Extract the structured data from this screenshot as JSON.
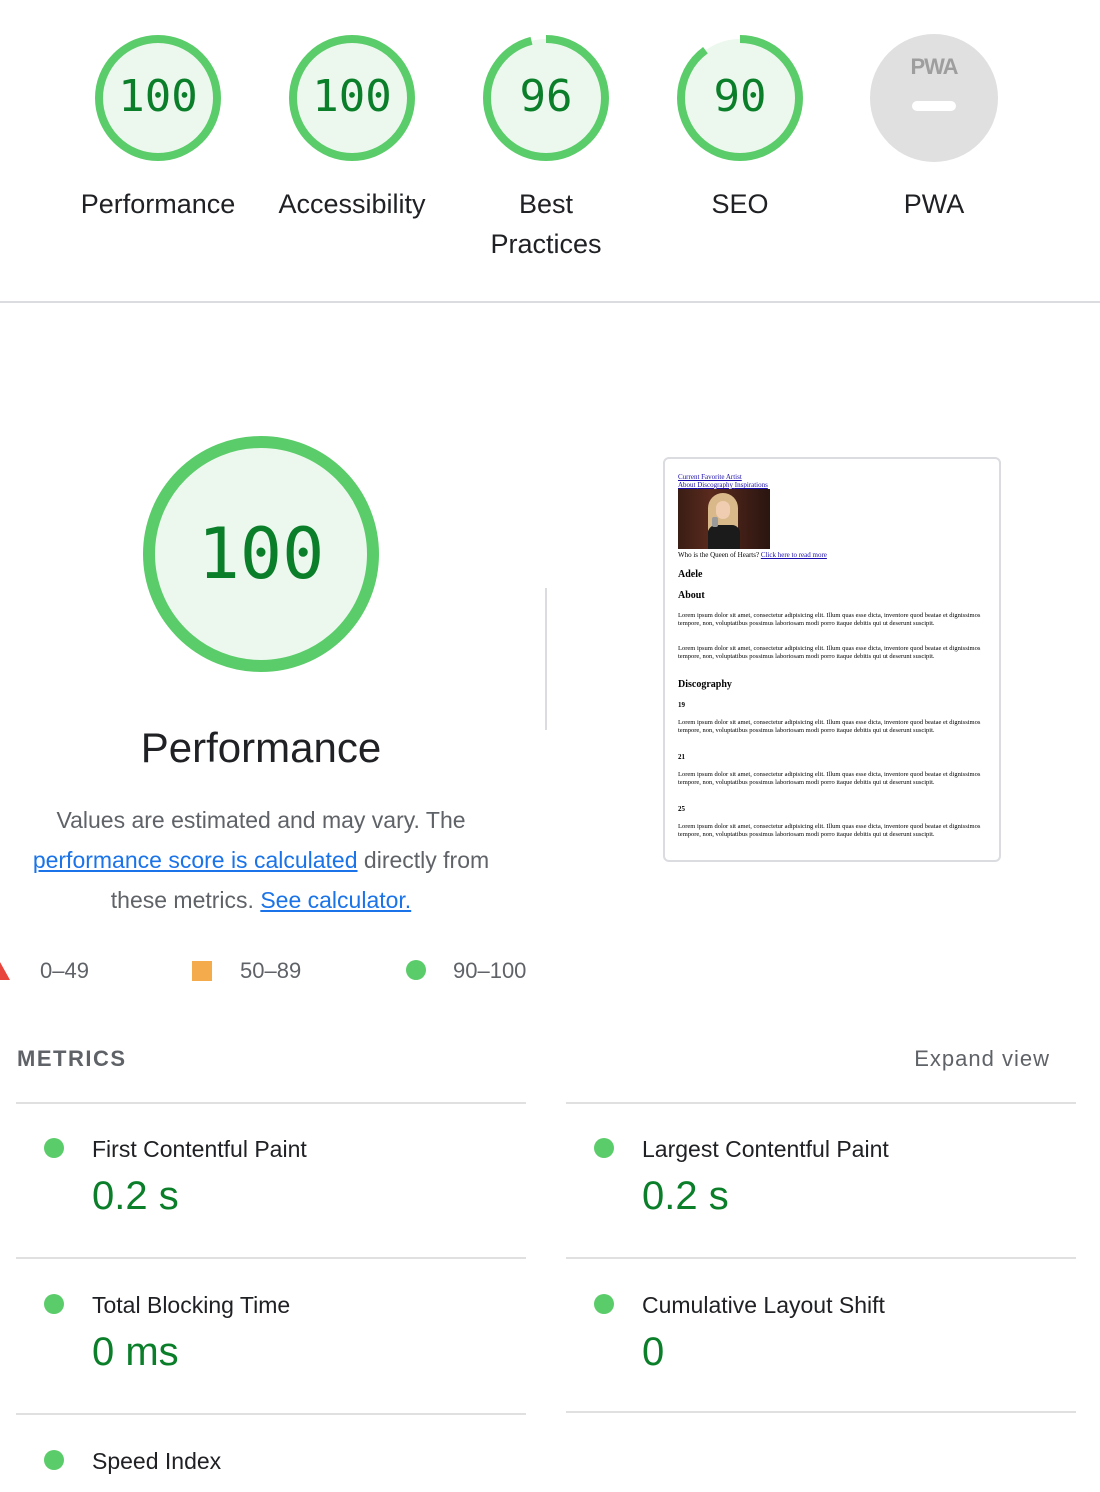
{
  "categories": [
    {
      "label": "Performance",
      "score": "100",
      "score_fraction": 1.0
    },
    {
      "label": "Accessibility",
      "score": "100",
      "score_fraction": 1.0
    },
    {
      "label": "Best Practices",
      "score": "96",
      "score_fraction": 0.96
    },
    {
      "label": "SEO",
      "score": "90",
      "score_fraction": 0.9
    },
    {
      "label": "PWA",
      "badge_text": "PWA",
      "score": "—"
    }
  ],
  "colors": {
    "pass_ring": "#5bcc6a",
    "pass_fill": "#ecf8ee",
    "pass_text": "#0b7e2a",
    "average": "#f4ab4b",
    "fail": "#e8453c",
    "na_fill": "#e0e0e0",
    "link": "#1a73e8"
  },
  "performance": {
    "score": "100",
    "score_fraction": 1.0,
    "title": "Performance",
    "desc_part1": "Values are estimated and may vary. The ",
    "desc_link1": "performance score is calculated",
    "desc_part2": " directly from these metrics. ",
    "desc_link2": "See calculator."
  },
  "legend": [
    {
      "shape": "triangle",
      "range": "0–49"
    },
    {
      "shape": "square",
      "range": "50–89"
    },
    {
      "shape": "circle",
      "range": "90–100"
    }
  ],
  "thumbnail": {
    "site_title": "Current Favorite Artist",
    "nav": [
      "About",
      "Discography",
      "Inspirations"
    ],
    "caption": "Who is the Queen of Hearts? ",
    "caption_link": "Click here to read more",
    "heading": "Adele",
    "about_heading": "About",
    "lorem": "Lorem ipsum dolor sit amet, consectetur adipisicing elit. Illum quas esse dicta, inventore quod beatae et dignissimos tempore, non, voluptatibus possimus laboriosam modi porro itaque debitis qui ut deserunt suscipit.",
    "discography_heading": "Discography",
    "albums": [
      "19",
      "21",
      "25"
    ]
  },
  "metrics": {
    "title": "METRICS",
    "expand_label": "Expand view",
    "items": [
      {
        "name": "First Contentful Paint",
        "value": "0.2 s"
      },
      {
        "name": "Largest Contentful Paint",
        "value": "0.2 s"
      },
      {
        "name": "Total Blocking Time",
        "value": "0 ms"
      },
      {
        "name": "Cumulative Layout Shift",
        "value": "0"
      },
      {
        "name": "Speed Index",
        "value": ""
      }
    ]
  }
}
